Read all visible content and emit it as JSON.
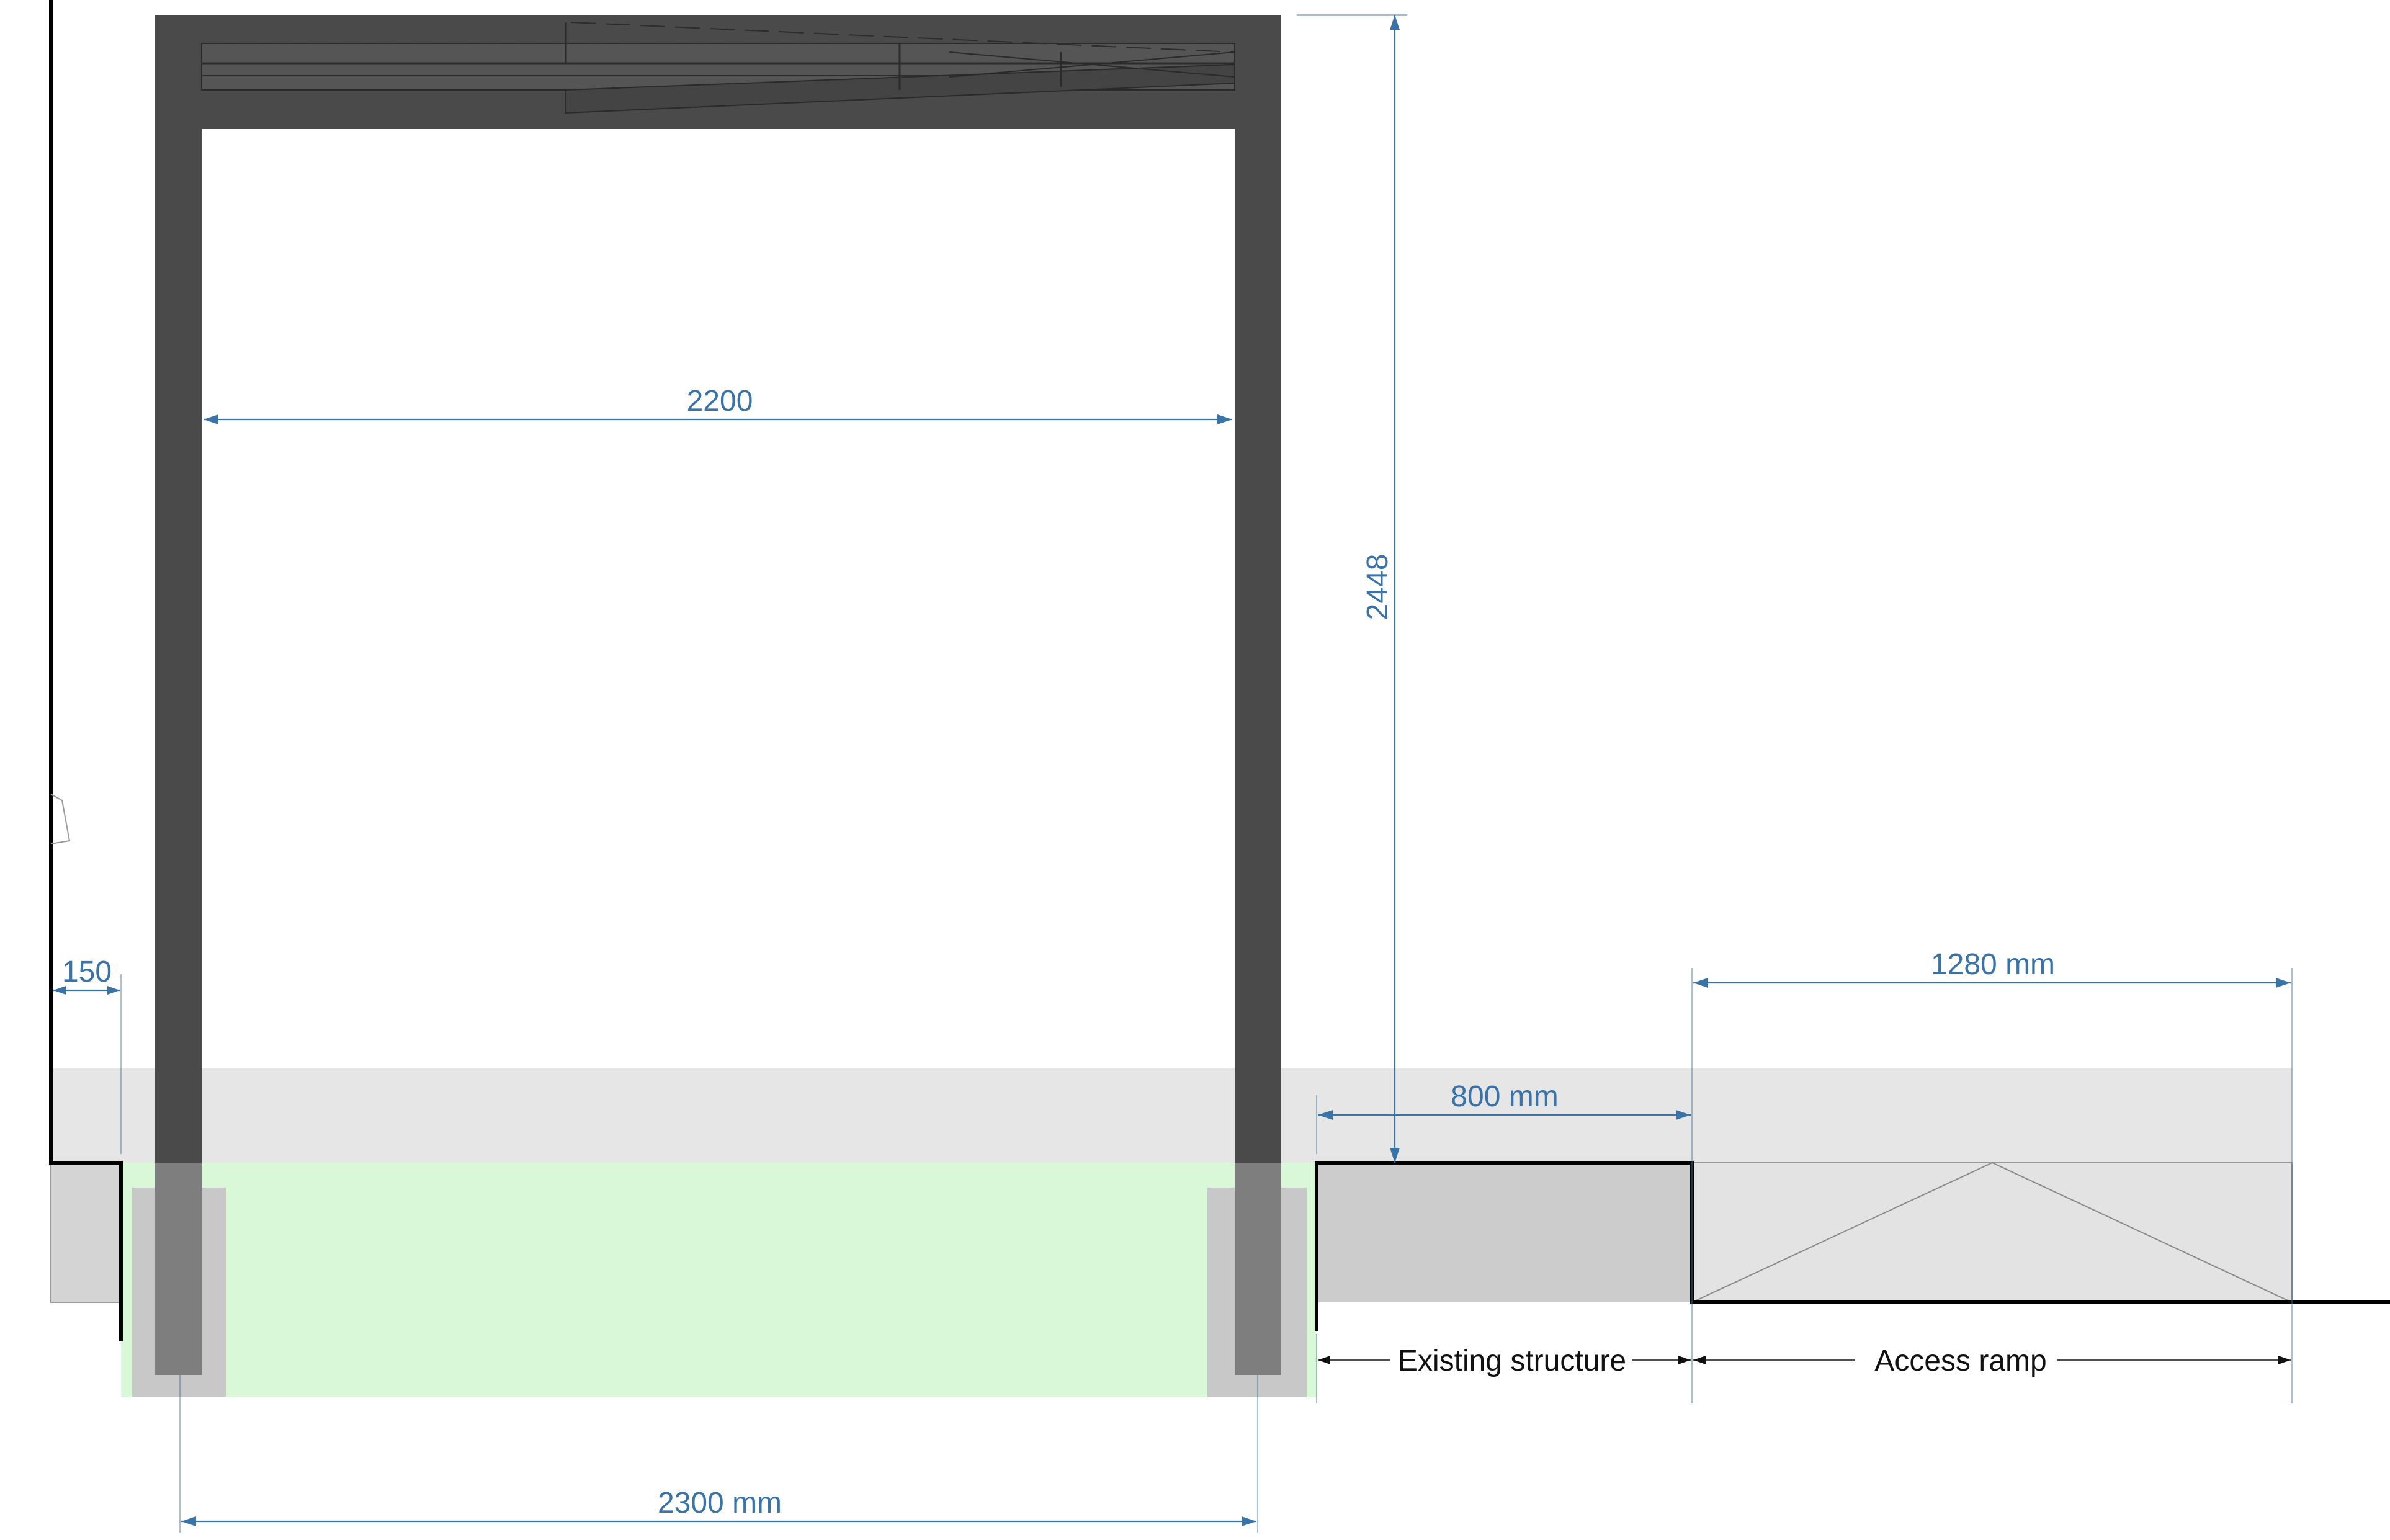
{
  "dimensions": {
    "clear_width": "2200",
    "clear_height": "2448",
    "wall_offset": "150",
    "footing_span": "2300 mm",
    "existing_depth": "800 mm",
    "ramp_length": "1280 mm"
  },
  "labels": {
    "existing_structure": "Existing structure",
    "access_ramp": "Access ramp"
  },
  "colors": {
    "frame": "#4a4a4a",
    "foundation_highlight": "#d8f8d8",
    "ground_band": "#e6e6e6",
    "existing_block": "#cccccc",
    "ramp_block": "#e3e3e3",
    "dimension": "#3a73a8"
  }
}
